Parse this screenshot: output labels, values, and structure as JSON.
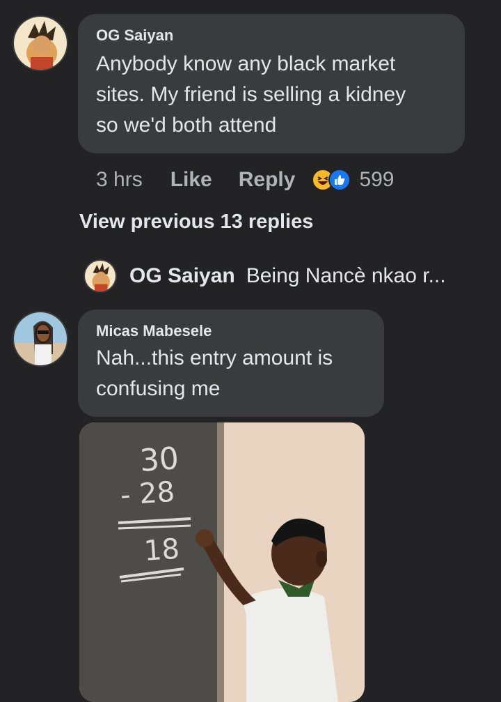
{
  "comment1": {
    "author": "OG Saiyan",
    "lines": [
      "Anybody know any black market",
      "sites. My friend is selling a kidney",
      "so we'd both attend"
    ],
    "time": "3 hrs",
    "like_label": "Like",
    "reply_label": "Reply",
    "reaction_count": "599",
    "reaction_icons": [
      "haha-emoji-icon",
      "thumbs-up-icon"
    ]
  },
  "view_previous": "View previous 13 replies",
  "reply_preview": {
    "author": "OG Saiyan",
    "snippet": "Being Nancè nkao r..."
  },
  "comment2": {
    "author": "Micas Mabesele",
    "lines": [
      "Nah...this entry amount is",
      "confusing me"
    ],
    "meme": {
      "chalk_numbers": [
        "30",
        "- 28",
        "18"
      ]
    }
  },
  "colors": {
    "background": "#232325",
    "bubble": "#3a3b3c",
    "text": "#e4e6eb",
    "muted": "#b0b3b8",
    "like_blue": "#1877f2",
    "haha_yellow": "#f7b928"
  }
}
